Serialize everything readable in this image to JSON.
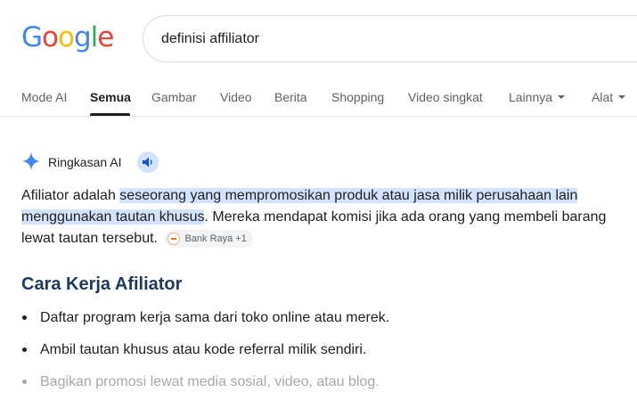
{
  "header": {
    "logo_letters": [
      "G",
      "o",
      "o",
      "g",
      "l",
      "e"
    ],
    "search_query": "definisi affiliator"
  },
  "tabs": [
    {
      "label": "Mode AI",
      "active": false
    },
    {
      "label": "Semua",
      "active": true
    },
    {
      "label": "Gambar",
      "active": false
    },
    {
      "label": "Video",
      "active": false
    },
    {
      "label": "Berita",
      "active": false
    },
    {
      "label": "Shopping",
      "active": false
    },
    {
      "label": "Video singkat",
      "active": false
    },
    {
      "label": "Lainnya",
      "active": false,
      "dropdown": true
    },
    {
      "label": "Alat",
      "active": false,
      "dropdown": true
    }
  ],
  "ai_overview": {
    "title": "Ringkasan AI",
    "icons": {
      "sparkle": "sparkle-icon",
      "listen": "speaker-icon"
    },
    "summary": {
      "prefix": "Afiliator adalah ",
      "highlight": "seseorang yang mempromosikan produk atau jasa milik perusahaan lain menggunakan tautan khusus",
      "suffix": ". Mereka mendapat komisi jika ada orang yang membeli barang lewat tautan tersebut."
    },
    "source_chip": "Bank Raya +1",
    "section_title": "Cara Kerja Afiliator",
    "bullets": [
      "Daftar program kerja sama dari toko online atau merek.",
      "Ambil tautan khusus atau kode referral milik sendiri.",
      "Bagikan promosi lewat media sosial, video, atau blog."
    ]
  },
  "colors": {
    "highlight": "#d3e3fd",
    "section_title": "#1f3a5f",
    "sparkle": "#4285f4",
    "faded_text": "#a8a8a8"
  }
}
